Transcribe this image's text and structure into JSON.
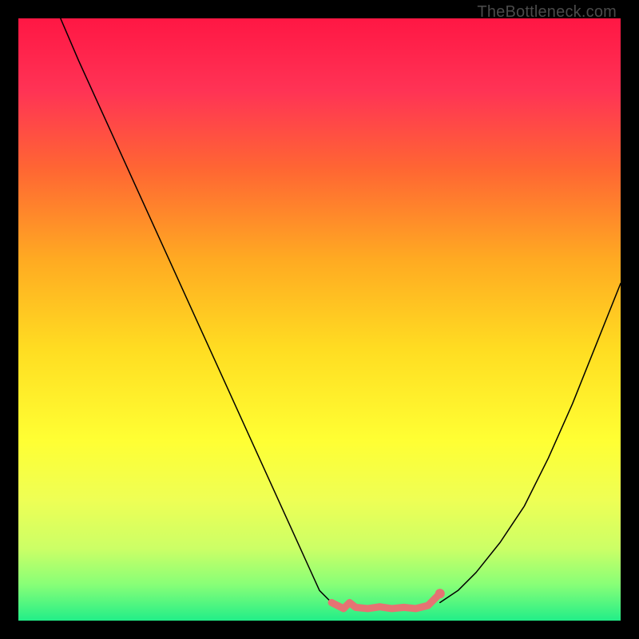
{
  "watermark": "TheBottleneck.com",
  "chart_data": {
    "type": "line",
    "title": "",
    "xlabel": "",
    "ylabel": "",
    "xlim": [
      0,
      100
    ],
    "ylim": [
      0,
      100
    ],
    "background_gradient": {
      "type": "vertical",
      "stops": [
        {
          "offset": 0,
          "color": "#ff1744"
        },
        {
          "offset": 12,
          "color": "#ff3355"
        },
        {
          "offset": 25,
          "color": "#ff6633"
        },
        {
          "offset": 40,
          "color": "#ffaa22"
        },
        {
          "offset": 55,
          "color": "#ffdd22"
        },
        {
          "offset": 70,
          "color": "#ffff33"
        },
        {
          "offset": 80,
          "color": "#eeff55"
        },
        {
          "offset": 88,
          "color": "#ccff66"
        },
        {
          "offset": 94,
          "color": "#88ff77"
        },
        {
          "offset": 100,
          "color": "#22ee88"
        }
      ]
    },
    "series": [
      {
        "name": "left-descending",
        "color": "#000000",
        "stroke_width": 1.5,
        "x": [
          7,
          10,
          15,
          20,
          25,
          30,
          35,
          40,
          45,
          50,
          52
        ],
        "values": [
          100,
          93,
          82,
          71,
          60,
          49,
          38,
          27,
          16,
          5,
          3
        ]
      },
      {
        "name": "right-ascending",
        "color": "#000000",
        "stroke_width": 1.5,
        "x": [
          70,
          73,
          76,
          80,
          84,
          88,
          92,
          96,
          100
        ],
        "values": [
          3,
          5,
          8,
          13,
          19,
          27,
          36,
          46,
          56
        ]
      },
      {
        "name": "valley-squiggle",
        "color": "#e57373",
        "stroke_width": 9,
        "x": [
          52,
          54,
          55,
          56,
          58,
          60,
          62,
          64,
          66,
          68,
          70
        ],
        "values": [
          3.0,
          2.0,
          3.0,
          2.2,
          2.0,
          2.3,
          2.0,
          2.2,
          2.0,
          2.5,
          4.5
        ]
      }
    ],
    "points": [
      {
        "name": "right-dot",
        "x": 70,
        "y": 4.5,
        "color": "#e57373",
        "radius": 6
      }
    ]
  }
}
